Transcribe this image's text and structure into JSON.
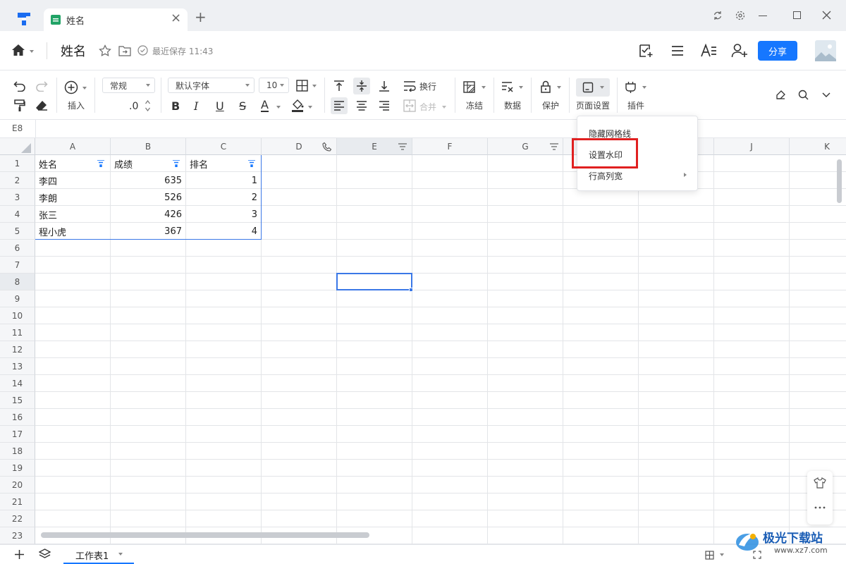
{
  "tab": {
    "title": "姓名",
    "close": "×",
    "new": "+"
  },
  "doc": {
    "title": "姓名",
    "save_status": "最近保存 11:43",
    "share_label": "分享"
  },
  "toolbar": {
    "insert": "插入",
    "format_select": "常规",
    "decimal": ".0",
    "font_select": "默认字体",
    "size_select": "10",
    "bold": "B",
    "italic": "I",
    "underline": "U",
    "strike": "S",
    "font_color": "A",
    "wrap": "换行",
    "merge": "合并",
    "freeze": "冻结",
    "data": "数据",
    "protect": "保护",
    "page_setup": "页面设置",
    "plugins": "插件"
  },
  "formula_bar": {
    "cell_ref": "E8"
  },
  "columns": [
    "A",
    "B",
    "C",
    "D",
    "E",
    "F",
    "G",
    "H",
    "I",
    "J",
    "K"
  ],
  "rows": [
    "1",
    "2",
    "3",
    "4",
    "5",
    "6",
    "7",
    "8",
    "9",
    "10",
    "11",
    "12",
    "13",
    "14",
    "15",
    "16",
    "17",
    "18",
    "19",
    "20",
    "21",
    "22",
    "23"
  ],
  "table": {
    "headers": [
      "姓名",
      "成绩",
      "排名"
    ],
    "rows": [
      [
        "李四",
        "635",
        "1"
      ],
      [
        "李朗",
        "526",
        "2"
      ],
      [
        "张三",
        "426",
        "3"
      ],
      [
        "程小虎",
        "367",
        "4"
      ]
    ]
  },
  "menu": {
    "items": [
      "隐藏网格线",
      "设置水印",
      "行高列宽"
    ]
  },
  "highlight_color": "#e02020",
  "accent_color": "#1677ff",
  "sheet_tab": "工作表1",
  "watermark": "极光下载站",
  "watermark_url": "www.xz7.com"
}
